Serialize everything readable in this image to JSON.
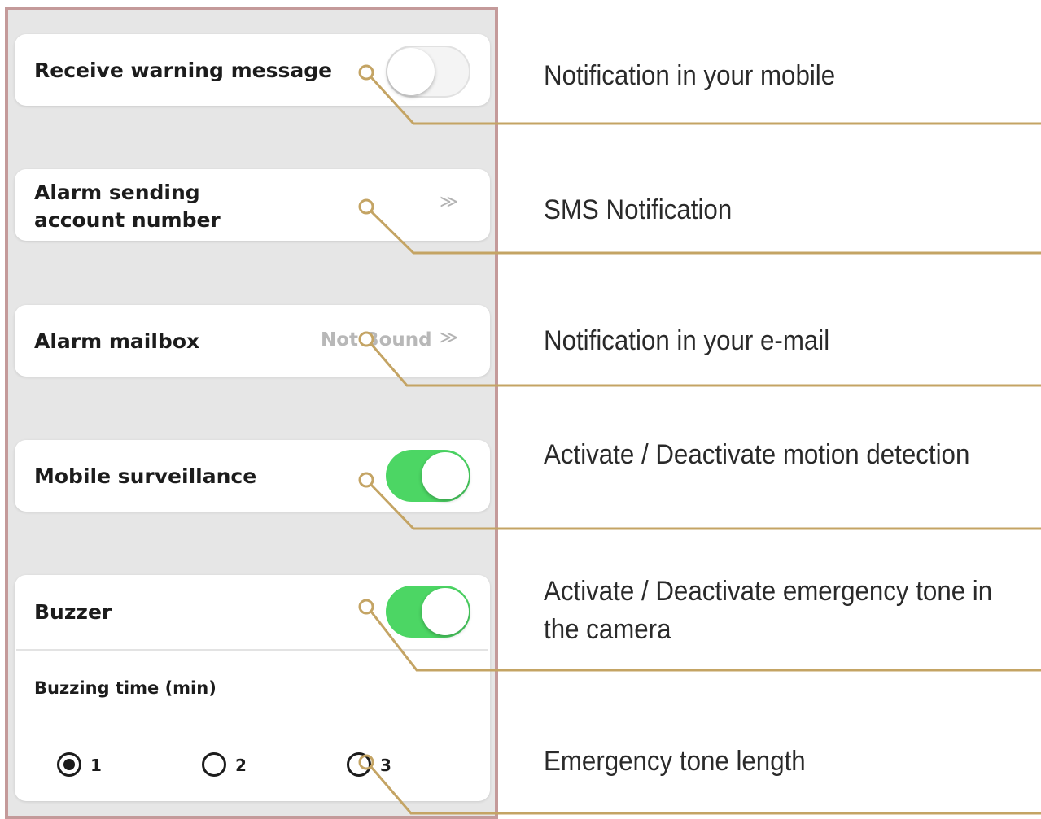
{
  "settings": {
    "receive_warning_message": {
      "label": "Receive warning message",
      "toggle_on": false
    },
    "alarm_sending_account": {
      "label_line1": "Alarm sending",
      "label_line2": "account number",
      "chevron": "≫"
    },
    "alarm_mailbox": {
      "label": "Alarm mailbox",
      "value": "Not Bound",
      "chevron": "≫"
    },
    "mobile_surveillance": {
      "label": "Mobile surveillance",
      "toggle_on": true
    },
    "buzzer": {
      "label": "Buzzer",
      "toggle_on": true,
      "buzzing_time_label": "Buzzing time (min)",
      "options": [
        "1",
        "2",
        "3"
      ],
      "selected_option": "1"
    }
  },
  "annotations": {
    "receive_warning_message": "Notification in your mobile",
    "alarm_sending_account": "SMS Notification",
    "alarm_mailbox": "Notification in your e-mail",
    "mobile_surveillance": "Activate / Deactivate motion detection",
    "buzzer_line1": "Activate / Deactivate emergency tone in",
    "buzzer_line2": "the camera",
    "buzzing_time": "Emergency tone length"
  },
  "colors": {
    "panel_border": "#c49a9a",
    "panel_background": "#e6e6e6",
    "toggle_on": "#4cd664",
    "callout_line": "#c4a464"
  }
}
